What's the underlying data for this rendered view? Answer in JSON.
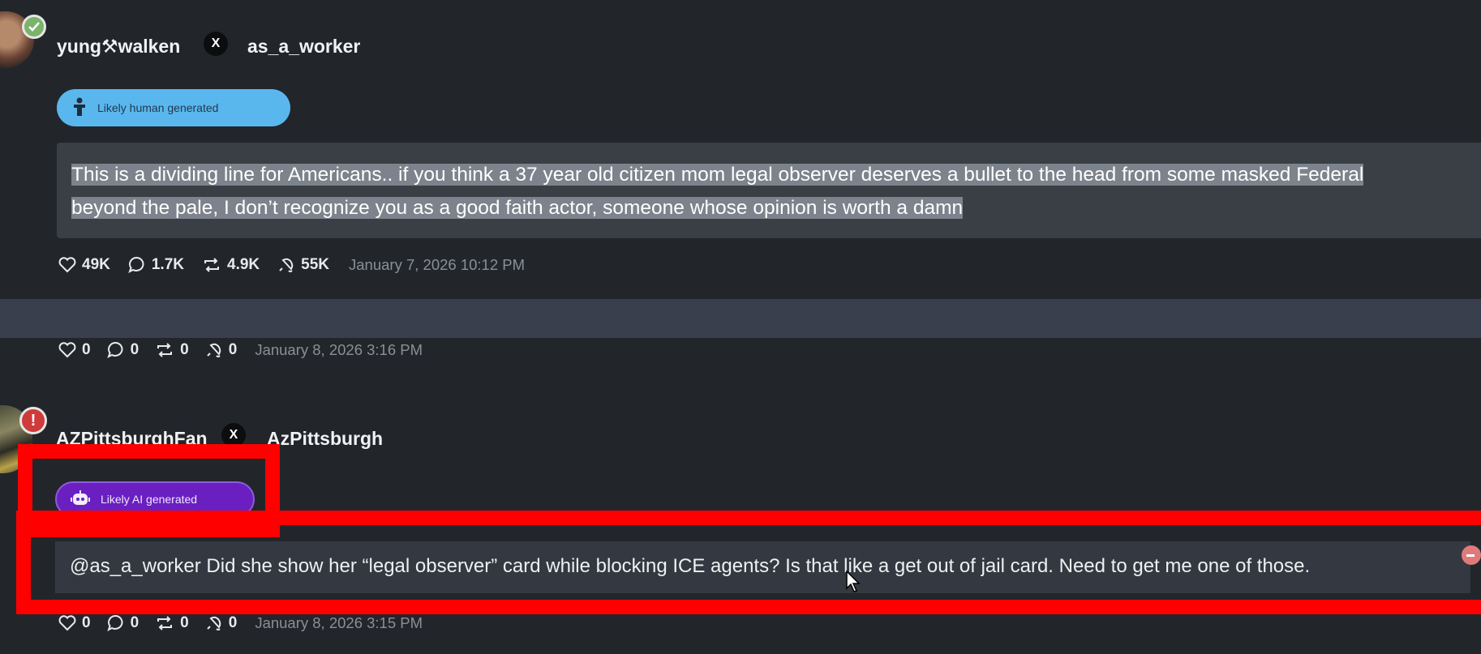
{
  "posts": [
    {
      "display_name": "yung⚒walken",
      "platform_icon": "x-logo-icon",
      "handle": "as_a_worker",
      "badge": {
        "label": "Likely human generated",
        "icon": "person-icon",
        "color": "#5ab7ee"
      },
      "text_lines": [
        "This is a dividing line for Americans.. if you think a 37 year old citizen mom legal observer deserves a bullet to the head from some masked Federal",
        "beyond the pale, I don’t recognize you as a good faith actor, someone whose opinion is worth a damn"
      ],
      "stats": {
        "likes": "49K",
        "replies": "1.7K",
        "reposts": "4.9K",
        "boosts": "55K"
      },
      "timestamp": "January 7, 2026 10:12 PM"
    },
    {
      "stats": {
        "likes": "0",
        "replies": "0",
        "reposts": "0",
        "boosts": "0"
      },
      "timestamp": "January 8, 2026 3:16 PM"
    },
    {
      "display_name": "AZPittsburghFan",
      "platform_icon": "x-logo-icon",
      "handle": "AzPittsburgh",
      "badge": {
        "label": "Likely AI generated",
        "icon": "robot-icon",
        "color": "#6a1fc0"
      },
      "text": "@as_a_worker Did she show her “legal observer” card while blocking ICE agents? Is that like a get out of jail card. Need to get me one of those.",
      "stats": {
        "likes": "0",
        "replies": "0",
        "reposts": "0",
        "boosts": "0"
      },
      "timestamp": "January 8, 2026 3:15 PM"
    }
  ],
  "colors": {
    "background": "#22262b",
    "divider": "#3a3f4e",
    "highlight": "#ff0000",
    "selection": "#7c838c"
  }
}
